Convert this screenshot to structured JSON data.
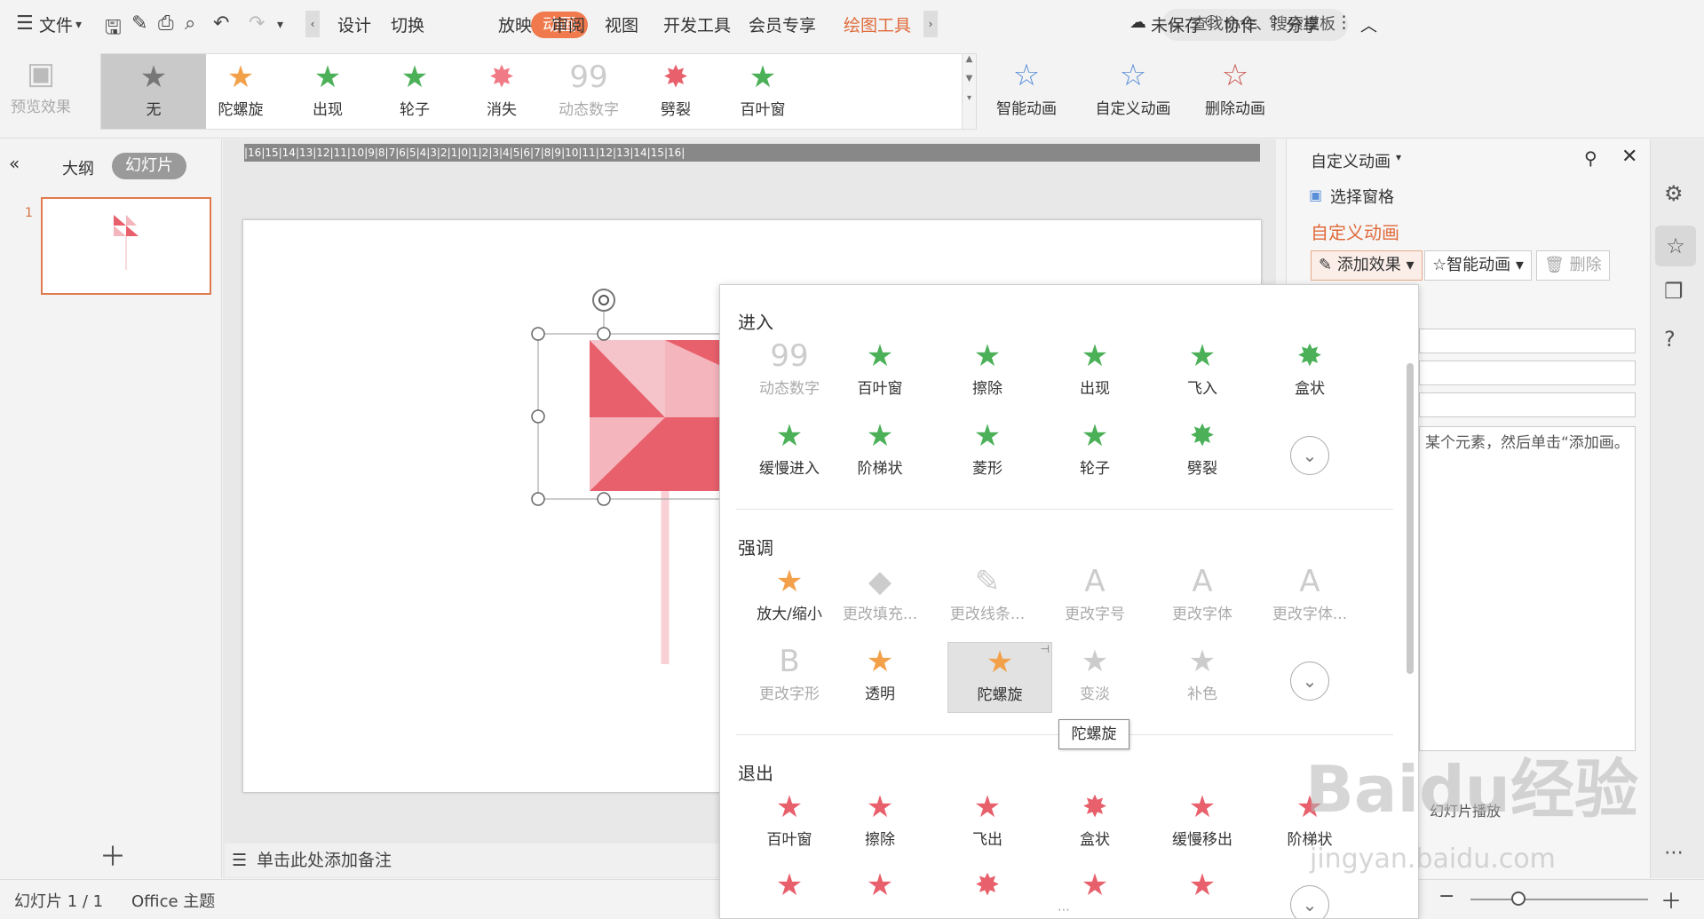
{
  "menu": {
    "file": "文件",
    "tabs": [
      "设计",
      "切换",
      "动画",
      "放映",
      "审阅",
      "视图",
      "开发工具",
      "会员专享"
    ],
    "active_tab": "动画",
    "drawing_tools": "绘图工具",
    "search_placeholder": "查找命令、搜索模板",
    "unsaved": "未保存",
    "collaborate": "协作",
    "share": "分享"
  },
  "ribbon": {
    "preview": "预览效果",
    "gallery": [
      "无",
      "陀螺旋",
      "出现",
      "轮子",
      "消失",
      "动态数字",
      "劈裂",
      "百叶窗"
    ],
    "smart_anim": "智能动画",
    "custom_anim": "自定义动画",
    "delete_anim": "删除动画"
  },
  "left_panel": {
    "outline": "大纲",
    "slides": "幻灯片",
    "slide_number": "1"
  },
  "ruler": "|16|15|14|13|12|11|10|9|8|7|6|5|4|3|2|1|0|1|2|3|4|5|6|7|8|9|10|11|12|13|14|15|16|",
  "notes_placeholder": "单击此处添加备注",
  "right_panel": {
    "header": "自定义动画",
    "selection_pane": "选择窗格",
    "title": "自定义动画",
    "add_effect": "添加效果",
    "smart_anim": "智能动画",
    "delete": "删除",
    "hint": "某个元素，然后单击“添加画。",
    "autoplay": "幻灯片播放"
  },
  "dropdown": {
    "enter_title": "进入",
    "enter": [
      "动态数字",
      "百叶窗",
      "擦除",
      "出现",
      "飞入",
      "盒状",
      "缓慢进入",
      "阶梯状",
      "菱形",
      "轮子",
      "劈裂"
    ],
    "emphasis_title": "强调",
    "emphasis": [
      "放大/缩小",
      "更改填充...",
      "更改线条...",
      "更改字号",
      "更改字体",
      "更改字体...",
      "更改字形",
      "透明",
      "陀螺旋",
      "变淡",
      "补色"
    ],
    "exit_title": "退出",
    "exit": [
      "百叶窗",
      "擦除",
      "飞出",
      "盒状",
      "缓慢移出",
      "阶梯状"
    ],
    "tooltip": "陀螺旋"
  },
  "status": {
    "slide_info": "幻灯片 1 / 1",
    "theme": "Office 主题"
  },
  "watermark": {
    "brand": "Baidu经验",
    "url": "jingyan.baidu.com"
  }
}
